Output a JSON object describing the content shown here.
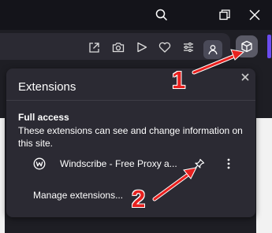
{
  "window": {
    "icons": [
      "search-icon",
      "restore-icon",
      "close-icon"
    ]
  },
  "toolbar": {
    "icons": [
      "share-icon",
      "camera-icon",
      "send-icon",
      "heart-icon",
      "easy-setup-icon",
      "profile-icon",
      "extensions-icon"
    ]
  },
  "popup": {
    "title": "Extensions",
    "section_title": "Full access",
    "section_desc": "These extensions can see and change information on this site.",
    "extensions": [
      {
        "name": "Windscribe - Free Proxy a...",
        "icon": "windscribe-logo-icon"
      }
    ],
    "manage_label": "Manage extensions..."
  },
  "annotations": {
    "step1": "1",
    "step2": "2",
    "color": "#e8211f"
  },
  "colors": {
    "accent": "#6b4cf0",
    "popup_bg": "#2b2a33"
  }
}
